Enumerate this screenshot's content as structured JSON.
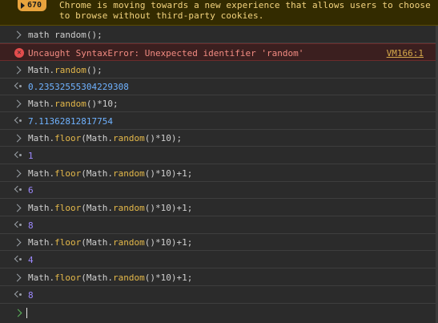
{
  "banner": {
    "count": "670",
    "message_line1": "Chrome is moving towards a new experience that allows users to choose",
    "message_line2": "to browse without third-party cookies."
  },
  "entries": [
    {
      "kind": "input",
      "parts": [
        {
          "t": "math random();",
          "c": "kw"
        }
      ]
    },
    {
      "kind": "error",
      "text": "Uncaught SyntaxError: Unexpected identifier 'random'",
      "source": "VM166:1"
    },
    {
      "kind": "input",
      "parts": [
        {
          "t": "Math.",
          "c": "kw"
        },
        {
          "t": "random",
          "c": "fn"
        },
        {
          "t": "();",
          "c": "kw"
        }
      ]
    },
    {
      "kind": "output",
      "style": "float",
      "value": "0.23532555304229308"
    },
    {
      "kind": "input",
      "parts": [
        {
          "t": "Math.",
          "c": "kw"
        },
        {
          "t": "random",
          "c": "fn"
        },
        {
          "t": "()*10;",
          "c": "kw"
        }
      ]
    },
    {
      "kind": "output",
      "style": "float",
      "value": "7.11362812817754"
    },
    {
      "kind": "input",
      "parts": [
        {
          "t": "Math.",
          "c": "kw"
        },
        {
          "t": "floor",
          "c": "fn"
        },
        {
          "t": "(Math.",
          "c": "kw"
        },
        {
          "t": "random",
          "c": "fn"
        },
        {
          "t": "()*10);",
          "c": "kw"
        }
      ]
    },
    {
      "kind": "output",
      "style": "int",
      "value": "1"
    },
    {
      "kind": "input",
      "parts": [
        {
          "t": "Math.",
          "c": "kw"
        },
        {
          "t": "floor",
          "c": "fn"
        },
        {
          "t": "(Math.",
          "c": "kw"
        },
        {
          "t": "random",
          "c": "fn"
        },
        {
          "t": "()*10)+1;",
          "c": "kw"
        }
      ]
    },
    {
      "kind": "output",
      "style": "int",
      "value": "6"
    },
    {
      "kind": "input",
      "parts": [
        {
          "t": "Math.",
          "c": "kw"
        },
        {
          "t": "floor",
          "c": "fn"
        },
        {
          "t": "(Math.",
          "c": "kw"
        },
        {
          "t": "random",
          "c": "fn"
        },
        {
          "t": "()*10)+1;",
          "c": "kw"
        }
      ]
    },
    {
      "kind": "output",
      "style": "int",
      "value": "8"
    },
    {
      "kind": "input",
      "parts": [
        {
          "t": "Math.",
          "c": "kw"
        },
        {
          "t": "floor",
          "c": "fn"
        },
        {
          "t": "(Math.",
          "c": "kw"
        },
        {
          "t": "random",
          "c": "fn"
        },
        {
          "t": "()*10)+1;",
          "c": "kw"
        }
      ]
    },
    {
      "kind": "output",
      "style": "int",
      "value": "4"
    },
    {
      "kind": "input",
      "parts": [
        {
          "t": "Math.",
          "c": "kw"
        },
        {
          "t": "floor",
          "c": "fn"
        },
        {
          "t": "(Math.",
          "c": "kw"
        },
        {
          "t": "random",
          "c": "fn"
        },
        {
          "t": "()*10)+1;",
          "c": "kw"
        }
      ]
    },
    {
      "kind": "output",
      "style": "int",
      "value": "8"
    }
  ],
  "colors": {
    "background": "#2b2b2b",
    "banner_bg": "#332b00",
    "badge": "#e8a33d",
    "error_bg": "#3b1f1f",
    "error_text": "#f28b82",
    "function_name": "#e5b94a",
    "int_result": "#9e89ff",
    "float_result": "#6fb2ff",
    "prompt_chevron": "#5cb85c"
  },
  "icons": {
    "banner_badge": "warning-triangle-icon",
    "input_row": "chevron-right-icon",
    "output_row": "return-arrow-icon",
    "error_row": "error-x-icon",
    "prompt": "chevron-right-icon"
  },
  "prompt": {
    "value": ""
  }
}
